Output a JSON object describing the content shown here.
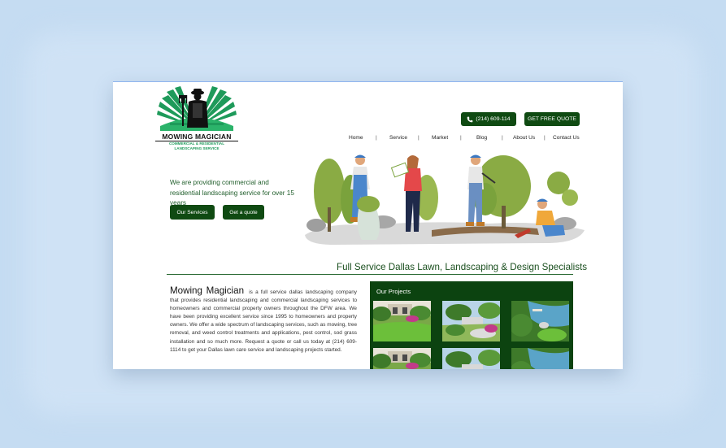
{
  "brand": {
    "name": "MOWING MAGICIAN",
    "tagline_line1": "COMMERCIAL & RESIDENTIAL",
    "tagline_line2": "LANDSCAPING SERVICE"
  },
  "header": {
    "phone_label": "(214) 609-114",
    "quote_label": "GET FREE QUOTE"
  },
  "nav": {
    "items": [
      "Home",
      "Service",
      "Market",
      "Blog",
      "About Us",
      "Contact Us"
    ]
  },
  "hero": {
    "text": "We are providing commercial and residential landscaping service for over 15 years",
    "primary_button": "Our Services",
    "secondary_button": "Get a quote"
  },
  "section": {
    "title": "Full Service Dallas Lawn, Landscaping & Design Specialists"
  },
  "about": {
    "title": "Mowing Magician",
    "body": "is a full service dallas landscaping company that provides residential landscaping and commercial landscaping services to homeowners and commercial property owners throughout the DFW area. We have been providing excellent service since 1995 to homeowners and property owners. We offer a wide spectrum of landscaping services, such as mowing, tree removal, and weed control treatments and applications, pest control, sod grass installation and so much more. Request a quote or call us today at (214) 609-1114 to get your Dallas lawn care service and landscaping projects started."
  },
  "projects": {
    "title": "Our Projects",
    "thumbnails": [
      "garden-house-photo",
      "backyard-patio-photo",
      "poolside-garden-photo",
      "garden-house-photo",
      "backyard-patio-photo",
      "poolside-garden-photo"
    ]
  },
  "colors": {
    "brand_green": "#0f4a12",
    "accent_green": "#1e9a5a",
    "page_background": "#c5dcf2"
  }
}
